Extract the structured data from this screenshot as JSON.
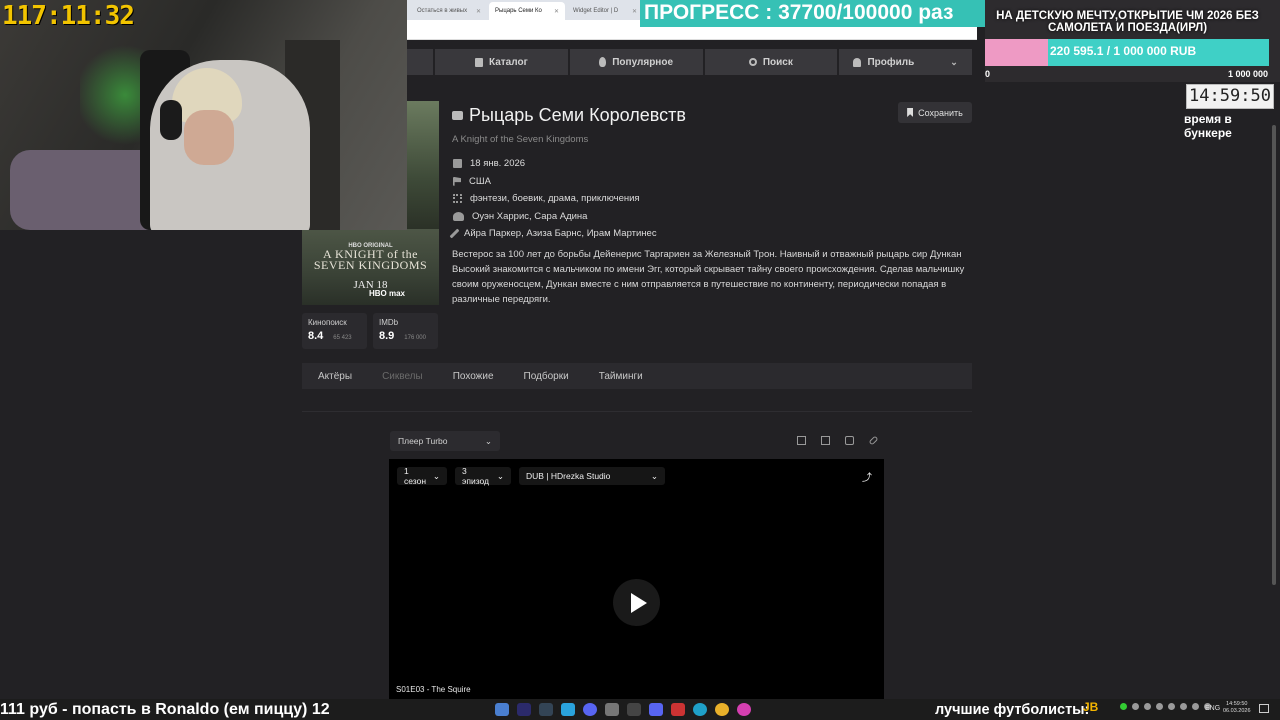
{
  "browser": {
    "tabs": [
      {
        "label": "Остаться в живых",
        "active": false
      },
      {
        "label": "Рыцарь Семи Ко",
        "active": true
      },
      {
        "label": "Widget Editor | D",
        "active": false
      }
    ]
  },
  "nav": {
    "items": [
      "Каталог",
      "Популярное",
      "Поиск",
      "Профиль"
    ]
  },
  "movie": {
    "title": "Рыцарь Семи Королевств",
    "subtitle": "A Knight of the Seven Kingdoms",
    "date": "18 янв. 2026",
    "country": "США",
    "genres": "фэнтези, боевик, драма, приключения",
    "creators": "Оуэн Харрис, Сара Адина",
    "writers": "Айра Паркер, Азиза Барнс, Ирам Мартинес",
    "description": "Вестерос за 100 лет до борьбы Дейенерис Таргариен за Железный Трон. Наивный и отважный рыцарь сир Дункан Высокий знакомится с мальчиком по имени Эгг, который скрывает тайну своего происхождения. Сделав мальчишку своим оруженосцем, Дункан вместе с ним отправляется в путешествие по континенту, периодически попадая в различные передряги.",
    "save_label": "Сохранить"
  },
  "poster": {
    "brand": "HBO ORIGINAL",
    "title_line1": "A KNIGHT of the",
    "title_line2": "SEVEN KINGDOMS",
    "date": "JAN 18",
    "network": "HBO max"
  },
  "ratings": [
    {
      "label": "Кинопоиск",
      "value": "8.4",
      "votes": "65 423"
    },
    {
      "label": "IMDb",
      "value": "8.9",
      "votes": "176 000"
    }
  ],
  "subnav": {
    "items": [
      "Актёры",
      "Сиквелы",
      "Похожие",
      "Подборки",
      "Тайминги"
    ]
  },
  "player": {
    "source": "Плеер Turbo",
    "season": "1 сезон",
    "episode": "3 эпизод",
    "dub": "DUB | HDrezka Studio",
    "episode_label": "S01E03 - The Squire"
  },
  "stream": {
    "timer": "117:11:32",
    "progress": "ПРОГРЕСС : 37700/100000 раз",
    "goal_title": "НА ДЕТСКУЮ МЕЧТУ,ОТКРЫТИЕ ЧМ 2026 БЕЗ САМОЛЕТА И ПОЕЗДА(ИРЛ)",
    "goal_amount": "220 595.1 / 1 000 000 RUB",
    "goal_min": "0",
    "goal_max": "1 000 000",
    "goal_fraction": 0.2206,
    "clock": "14:59:50",
    "bunker_label": "время в бункере",
    "ticker": "111 руб - попасть в Ronaldo (ем пиццу) 12",
    "footballers": "лучшие футболисты:",
    "jb": "JB"
  },
  "taskbar": {
    "lang": "ENG",
    "time": "14:59:50",
    "date": "06.03.2026"
  },
  "colors": {
    "accent_teal": "#3fd0c6",
    "goal_fill": "#ee9ac4",
    "timer": "#f2c400"
  }
}
